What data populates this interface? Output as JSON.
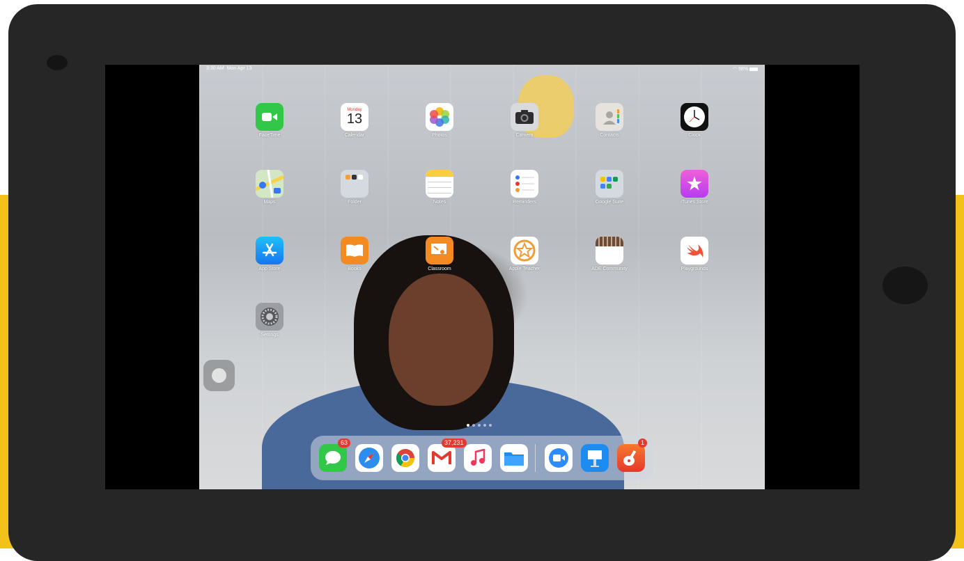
{
  "status_bar": {
    "time": "3:30 AM",
    "date": "Mon Apr 13",
    "battery": "98%"
  },
  "apps": [
    {
      "label": "FaceTime",
      "icon": "facetime-icon"
    },
    {
      "label": "Calendar",
      "icon": "calendar-icon",
      "day_name": "Monday",
      "day_number": "13"
    },
    {
      "label": "Photos",
      "icon": "photos-icon"
    },
    {
      "label": "Camera",
      "icon": "camera-icon"
    },
    {
      "label": "Contacts",
      "icon": "contacts-icon"
    },
    {
      "label": "Clock",
      "icon": "clock-icon"
    },
    {
      "label": "Maps",
      "icon": "maps-icon"
    },
    {
      "label": "Folder",
      "icon": "folder-icon"
    },
    {
      "label": "Notes",
      "icon": "notes-icon"
    },
    {
      "label": "Reminders",
      "icon": "reminders-icon"
    },
    {
      "label": "Google Suite",
      "icon": "google-suite-folder-icon"
    },
    {
      "label": "iTunes Store",
      "icon": "itunes-store-icon"
    },
    {
      "label": "App Store",
      "icon": "app-store-icon"
    },
    {
      "label": "Books",
      "icon": "books-icon"
    },
    {
      "label": "Classroom",
      "icon": "classroom-icon"
    },
    {
      "label": "Apple Teacher",
      "icon": "apple-teacher-icon"
    },
    {
      "label": "ADE Community",
      "icon": "ade-community-icon"
    },
    {
      "label": "Playgrounds",
      "icon": "swift-playgrounds-icon"
    },
    {
      "label": "Settings",
      "icon": "settings-icon"
    }
  ],
  "dock": {
    "messages_badge": "63",
    "gmail_badge": "37,231",
    "garageband_badge": "1",
    "items": [
      "messages-icon",
      "safari-icon",
      "chrome-icon",
      "gmail-icon",
      "music-icon",
      "files-icon",
      "zoom-icon",
      "keynote-icon",
      "garageband-icon"
    ]
  },
  "page_dots": {
    "count": 5,
    "active": 0
  },
  "colors": {
    "device": "#262626",
    "background_accent": "#f2c21b",
    "badge": "#e5382f"
  }
}
